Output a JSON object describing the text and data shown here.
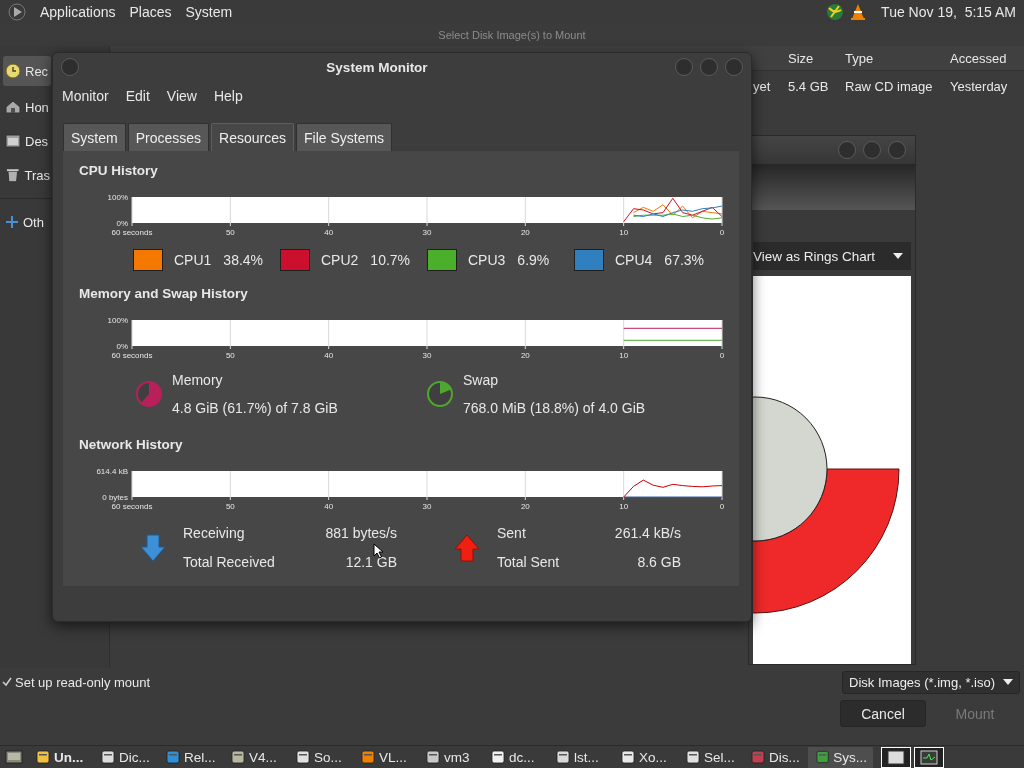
{
  "top_panel": {
    "menus": [
      "Applications",
      "Places",
      "System"
    ],
    "clock": "Tue Nov 19,  5:15 AM"
  },
  "mount_dialog": {
    "title": "Select Disk Image(s) to Mount",
    "places": [
      {
        "label": "Rec",
        "selected": true
      },
      {
        "label": "Hon",
        "selected": false
      },
      {
        "label": "Des",
        "selected": false
      },
      {
        "label": "Tras",
        "selected": false
      }
    ],
    "other_places": [
      {
        "label": "Oth",
        "selected": false
      }
    ],
    "columns": [
      "Size",
      "Type",
      "Accessed"
    ],
    "rows": [
      {
        "column_1": "yet",
        "size": "5.4 GB",
        "type": "Raw CD image",
        "accessed": "Yesterday"
      }
    ],
    "read_only": {
      "label": "Set up read-only mount",
      "checked": true
    },
    "filter": "Disk Images (*.img, *.iso)",
    "buttons": [
      {
        "label": "Cancel",
        "disabled": false
      },
      {
        "label": "Mount",
        "disabled": true
      }
    ]
  },
  "disk_usage_window": {
    "view_mode": "View as Rings Chart"
  },
  "system_monitor": {
    "title": "System Monitor",
    "menus": [
      "Monitor",
      "Edit",
      "View",
      "Help"
    ],
    "tabs": [
      {
        "label": "System",
        "selected": false
      },
      {
        "label": "Processes",
        "selected": false
      },
      {
        "label": "Resources",
        "selected": true
      },
      {
        "label": "File Systems",
        "selected": false
      }
    ],
    "cpu": {
      "title": "CPU History",
      "chart_data": {
        "type": "line",
        "grid": true,
        "x": [
          10,
          9,
          8,
          7,
          6,
          5,
          4,
          3,
          2,
          1,
          0
        ],
        "xlim": [
          60,
          0
        ],
        "ylim": [
          0,
          100
        ],
        "xticks": [
          {
            "value": 60,
            "label": "60 seconds"
          },
          50,
          40,
          30,
          20,
          10,
          0
        ],
        "yticks": [
          {
            "value": 0,
            "label": "0%"
          },
          {
            "value": 100,
            "label": "100%"
          }
        ],
        "series": [
          {
            "color": "#f57900",
            "values": [
              null,
              40,
              60,
              45,
              70,
              30,
              65,
              20,
              45,
              40,
              35
            ]
          },
          {
            "color": "#cc0f2c",
            "values": [
              5,
              55,
              50,
              35,
              40,
              95,
              40,
              30,
              45,
              60,
              25
            ]
          },
          {
            "color": "#4caf2c",
            "values": [
              null,
              25,
              30,
              30,
              30,
              35,
              25,
              30,
              20,
              15,
              20
            ]
          },
          {
            "color": "#3080c0",
            "values": [
              null,
              30,
              25,
              35,
              25,
              40,
              50,
              45,
              55,
              58,
              65
            ]
          }
        ]
      },
      "legend": [
        {
          "name": "CPU1",
          "value": "38.4%",
          "color": "#f57900"
        },
        {
          "name": "CPU2",
          "value": "10.7%",
          "color": "#cc0f2c"
        },
        {
          "name": "CPU3",
          "value": "6.9%",
          "color": "#4caf2c"
        },
        {
          "name": "CPU4",
          "value": "67.3%",
          "color": "#3080c0"
        }
      ]
    },
    "memory": {
      "title": "Memory and Swap History",
      "chart_data": {
        "type": "line",
        "grid": true,
        "x": [
          10,
          0
        ],
        "xlim": [
          60,
          0
        ],
        "ylim": [
          0,
          100
        ],
        "xticks": [
          {
            "value": 60,
            "label": "60 seconds"
          },
          50,
          40,
          30,
          20,
          10,
          0
        ],
        "yticks": [
          {
            "value": 0,
            "label": "0%"
          },
          {
            "value": 100,
            "label": "100%"
          }
        ],
        "series": [
          {
            "color": "#b8205a",
            "values": [
              68,
              68
            ]
          },
          {
            "color": "#4ea72e",
            "values": [
              22,
              22
            ]
          }
        ]
      },
      "items": [
        {
          "name": "Memory",
          "value": "4.8 GiB (61.7%) of 7.8 GiB",
          "color": "#b8205a"
        },
        {
          "name": "Swap",
          "value": "768.0 MiB (18.8%) of 4.0 GiB",
          "color": "#4ea72e"
        }
      ]
    },
    "network": {
      "title": "Network History",
      "chart_data": {
        "type": "line",
        "grid": true,
        "x": [
          10,
          9,
          8,
          7,
          6,
          5,
          4,
          3,
          2,
          1,
          0
        ],
        "xlim": [
          60,
          0
        ],
        "ylim": [
          0,
          614.4
        ],
        "xticks": [
          {
            "value": 60,
            "label": "60 seconds"
          },
          50,
          40,
          30,
          20,
          10,
          0
        ],
        "yticks": [
          {
            "value": 0,
            "label": "0 bytes"
          },
          {
            "value": 614.4,
            "label": "614.4 kB"
          }
        ],
        "series": [
          {
            "color": "#3465a4",
            "values": [
              0,
              0,
              0,
              0,
              0,
              0,
              0,
              0,
              0,
              0,
              0
            ]
          },
          {
            "color": "#cc0000",
            "values": [
              0,
              250,
              400,
              280,
              230,
              300,
              270,
              250,
              240,
              260,
              270
            ]
          }
        ]
      },
      "items": [
        {
          "kind": "download",
          "rate_label": "Receiving",
          "rate": "881 bytes/s",
          "total_label": "Total Received",
          "total": "12.1 GB"
        },
        {
          "kind": "upload",
          "rate_label": "Sent",
          "rate": "261.4 kB/s",
          "total_label": "Total Sent",
          "total": "8.6 GB"
        }
      ]
    }
  },
  "taskbar": {
    "items": [
      {
        "label": "Un...",
        "selected": false,
        "urgent": true
      },
      {
        "label": "Dic...",
        "selected": false,
        "urgent": false
      },
      {
        "label": "Rel...",
        "selected": false,
        "urgent": false
      },
      {
        "label": "V4...",
        "selected": false,
        "urgent": false
      },
      {
        "label": "So...",
        "selected": false,
        "urgent": false
      },
      {
        "label": "VL...",
        "selected": false,
        "urgent": false
      },
      {
        "label": "vm3",
        "selected": false,
        "urgent": false
      },
      {
        "label": "dc...",
        "selected": false,
        "urgent": false
      },
      {
        "label": "lst...",
        "selected": false,
        "urgent": false
      },
      {
        "label": "Xo...",
        "selected": false,
        "urgent": false
      },
      {
        "label": "Sel...",
        "selected": false,
        "urgent": false
      },
      {
        "label": "Dis...",
        "selected": false,
        "urgent": false
      },
      {
        "label": "Sys...",
        "selected": true,
        "urgent": false
      }
    ]
  }
}
